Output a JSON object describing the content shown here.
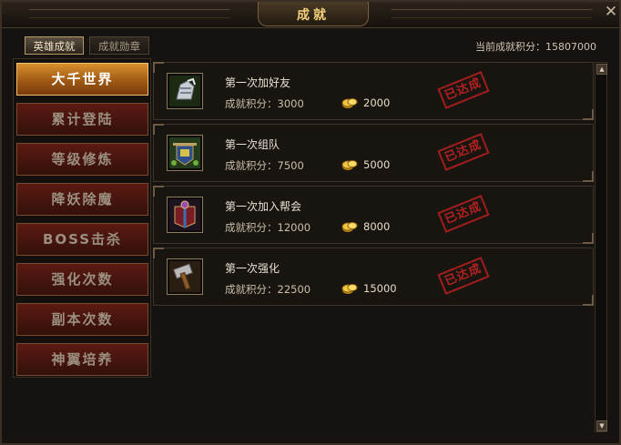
{
  "window": {
    "title": "成就",
    "close_icon": "close-icon"
  },
  "tabs": [
    {
      "label": "英雄成就",
      "active": true
    },
    {
      "label": "成就勋章",
      "active": false
    }
  ],
  "score": {
    "label": "当前成就积分：",
    "value": "15807000"
  },
  "sidebar": {
    "items": [
      {
        "label": "大千世界",
        "active": true
      },
      {
        "label": "累计登陆",
        "active": false
      },
      {
        "label": "等级修炼",
        "active": false
      },
      {
        "label": "降妖除魔",
        "active": false
      },
      {
        "label": "BOSS击杀",
        "active": false
      },
      {
        "label": "强化次数",
        "active": false
      },
      {
        "label": "副本次数",
        "active": false
      },
      {
        "label": "神翼培养",
        "active": false
      }
    ]
  },
  "achievements": [
    {
      "name": "第一次加好友",
      "points_label": "成就积分：3000",
      "reward": "2000",
      "status": "已达成",
      "icon": "gauntlet-icon"
    },
    {
      "name": "第一次组队",
      "points_label": "成就积分：7500",
      "reward": "5000",
      "status": "已达成",
      "icon": "banner-icon"
    },
    {
      "name": "第一次加入帮会",
      "points_label": "成就积分：12000",
      "reward": "8000",
      "status": "已达成",
      "icon": "guild-icon"
    },
    {
      "name": "第一次强化",
      "points_label": "成就积分：22500",
      "reward": "15000",
      "status": "已达成",
      "icon": "hammer-icon"
    }
  ],
  "colors": {
    "accent_gold": "#f3d27a",
    "stamp_red": "#c42222",
    "menu_active": "#d8902e",
    "menu_inactive": "#5b1a12"
  }
}
